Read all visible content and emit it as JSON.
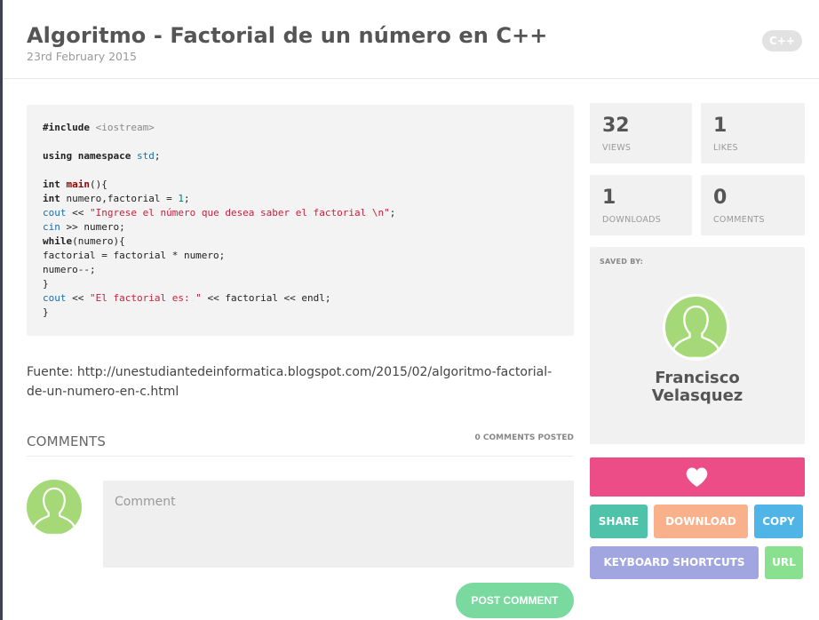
{
  "snippet": {
    "title": "Algoritmo - Factorial de un número en C++",
    "date": "23rd February 2015",
    "language": "C++"
  },
  "code": {
    "line1_kw": "#include",
    "line1_inc": " <iostream>",
    "line3_kw": "using namespace",
    "line3_std": "std",
    "line3_end": ";",
    "line5_kw": "int",
    "line5_fn": "main",
    "line5_end": "(){",
    "line6_kw": "int",
    "line6_mid": " numero,factorial = ",
    "line6_num": "1",
    "line6_end": ";",
    "line7_std": "cout",
    "line7_mid": " << ",
    "line7_str": "\"Ingrese el número que desea saber el factorial \\n\"",
    "line7_end": ";",
    "line8_std": "cin",
    "line8_end": " >> numero;",
    "line9_kw": "while",
    "line9_end": "(numero){",
    "line10": "factorial = factorial * numero;",
    "line11": "numero--;",
    "line12": "}",
    "line13_std": "cout",
    "line13_mid": " << ",
    "line13_str": "\"El factorial es: \"",
    "line13_end": " << factorial << endl;",
    "line14": "}"
  },
  "source_text": "Fuente: http://unestudiantedeinformatica.blogspot.com/2015/02/algoritmo-factorial-de-un-numero-en-c.html",
  "comments": {
    "title": "COMMENTS",
    "count_label": "0 COMMENTS POSTED",
    "placeholder": "Comment",
    "post_label": "POST COMMENT"
  },
  "stats": {
    "views": "32",
    "views_label": "VIEWS",
    "likes": "1",
    "likes_label": "LIKES",
    "downloads": "1",
    "downloads_label": "DOWNLOADS",
    "comments": "0",
    "comments_label": "COMMENTS"
  },
  "saved_by": {
    "label": "SAVED BY:",
    "first_name": "Francisco",
    "last_name": "Velasquez"
  },
  "actions": {
    "share": "SHARE",
    "download": "DOWNLOAD",
    "copy": "COPY",
    "shortcuts": "KEYBOARD SHORTCUTS",
    "url": "URL"
  },
  "icons": {
    "avatar": "user-silhouette-icon",
    "like": "heart-icon"
  },
  "colors": {
    "like": "#ec4d87",
    "share": "#4ec3a9",
    "download": "#f9b18b",
    "copy": "#4fb4e6",
    "shortcuts": "#a2a6e0",
    "url": "#89e08f",
    "post": "#79d99e",
    "avatar": "#a5d977"
  }
}
